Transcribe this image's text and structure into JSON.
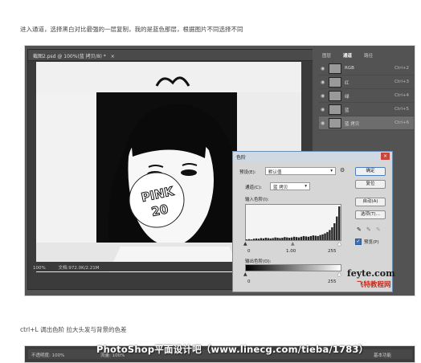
{
  "article": {
    "intro": "进入通道，选择黑白对比最强的一层复制，我的是蓝色那层，根据图片不同选择不同",
    "caption": "ctrl+L 调出色阶 拉大头发与背景的色差"
  },
  "document": {
    "tab_title": "截图2.psd @ 100%(蓝 拷贝/8) *",
    "zoom": "100%",
    "doc_info": "文档:972.0K/2.21M",
    "sign_text_line1": "PINK",
    "sign_text_line2": "20"
  },
  "panel": {
    "tabs": [
      "图层",
      "通道",
      "路径"
    ],
    "channels": [
      {
        "name": "RGB",
        "shortcut": "Ctrl+2",
        "selected": false
      },
      {
        "name": "红",
        "shortcut": "Ctrl+3",
        "selected": false
      },
      {
        "name": "绿",
        "shortcut": "Ctrl+4",
        "selected": false
      },
      {
        "name": "蓝",
        "shortcut": "Ctrl+5",
        "selected": false
      },
      {
        "name": "蓝 拷贝",
        "shortcut": "Ctrl+6",
        "selected": true
      }
    ]
  },
  "levels": {
    "title": "色阶",
    "preset_label": "预设(E):",
    "preset_value": "默认值",
    "channel_label": "通道(C):",
    "channel_value": "蓝 拷贝",
    "input_label": "输入色阶(I):",
    "input_values": [
      "0",
      "1.00",
      "255"
    ],
    "output_label": "输出色阶(O):",
    "output_values": [
      "0",
      "255"
    ],
    "buttons": [
      "确定",
      "复位",
      "自动(A)",
      "选项(T)..."
    ],
    "preview_label": "预览(P)",
    "preview_checked": true,
    "histogram": [
      0.02,
      0.03,
      0.02,
      0.04,
      0.05,
      0.04,
      0.06,
      0.05,
      0.07,
      0.06,
      0.05,
      0.06,
      0.08,
      0.07,
      0.06,
      0.07,
      0.09,
      0.08,
      0.07,
      0.08,
      0.1,
      0.09,
      0.08,
      0.1,
      0.12,
      0.11,
      0.1,
      0.12,
      0.14,
      0.13,
      0.12,
      0.15,
      0.17,
      0.2,
      0.24,
      0.3,
      0.38,
      0.5,
      0.7,
      1.0
    ]
  },
  "watermarks": {
    "right_top": "feyte.com",
    "right_bottom": "飞特教程网",
    "bottom": "PhotoShop平面设计吧（www.linecg.com/tieba/1783）"
  },
  "bottom_bar": {
    "opacity": "不透明度: 100%",
    "flow": "流量: 100%",
    "workspace": "基本功能"
  }
}
